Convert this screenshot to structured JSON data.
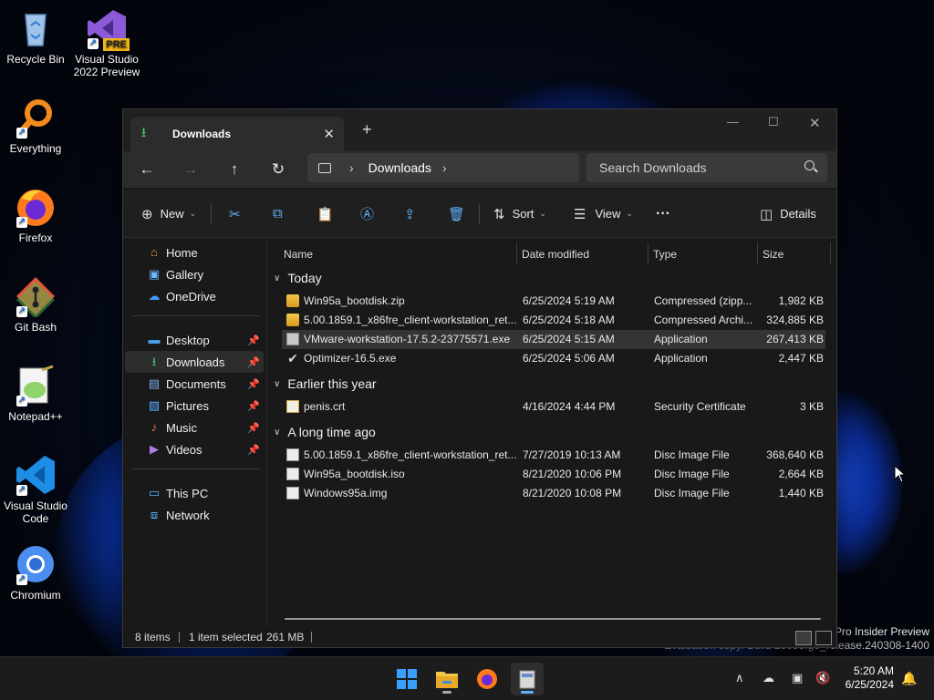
{
  "desktop": {
    "icons": [
      {
        "label": "Recycle Bin"
      },
      {
        "label": "Visual Studio 2022 Preview",
        "badge": "PRE"
      },
      {
        "label": "Everything"
      },
      {
        "label": "Firefox"
      },
      {
        "label": "Git Bash"
      },
      {
        "label": "Notepad++"
      },
      {
        "label": "Visual Studio Code"
      },
      {
        "label": "Chromium"
      }
    ],
    "watermark": {
      "line1": "Pro Insider Preview",
      "line2": "Evaluation copy. Build 26058.ge_release.240308-1400"
    }
  },
  "window": {
    "tab": {
      "title": "Downloads",
      "icon": "download-icon"
    },
    "address": {
      "crumb": "Downloads"
    },
    "search": {
      "placeholder": "Search Downloads"
    },
    "commands": {
      "new_label": "New",
      "sort_label": "Sort",
      "view_label": "View",
      "details_label": "Details"
    },
    "nav": {
      "items": [
        {
          "label": "Home"
        },
        {
          "label": "Gallery"
        },
        {
          "label": "OneDrive"
        },
        {
          "label": "Desktop"
        },
        {
          "label": "Downloads"
        },
        {
          "label": "Documents"
        },
        {
          "label": "Pictures"
        },
        {
          "label": "Music"
        },
        {
          "label": "Videos"
        },
        {
          "label": "This PC"
        },
        {
          "label": "Network"
        }
      ]
    },
    "columns": {
      "name": "Name",
      "date": "Date modified",
      "type": "Type",
      "size": "Size"
    },
    "groups": {
      "today": "Today",
      "earlier": "Earlier this year",
      "longago": "A long time ago"
    },
    "files": [
      {
        "name": "Win95a_bootdisk.zip",
        "date": "6/25/2024 5:19 AM",
        "type": "Compressed (zipp...",
        "size": "1,982 KB"
      },
      {
        "name": "5.00.1859.1_x86fre_client-workstation_ret...",
        "date": "6/25/2024 5:18 AM",
        "type": "Compressed Archi...",
        "size": "324,885 KB"
      },
      {
        "name": "VMware-workstation-17.5.2-23775571.exe",
        "date": "6/25/2024 5:15 AM",
        "type": "Application",
        "size": "267,413 KB"
      },
      {
        "name": "Optimizer-16.5.exe",
        "date": "6/25/2024 5:06 AM",
        "type": "Application",
        "size": "2,447 KB"
      },
      {
        "name": "penis.crt",
        "date": "4/16/2024 4:44 PM",
        "type": "Security Certificate",
        "size": "3 KB"
      },
      {
        "name": "5.00.1859.1_x86fre_client-workstation_ret...",
        "date": "7/27/2019 10:13 AM",
        "type": "Disc Image File",
        "size": "368,640 KB"
      },
      {
        "name": "Win95a_bootdisk.iso",
        "date": "8/21/2020 10:06 PM",
        "type": "Disc Image File",
        "size": "2,664 KB"
      },
      {
        "name": "Windows95a.img",
        "date": "8/21/2020 10:08 PM",
        "type": "Disc Image File",
        "size": "1,440 KB"
      }
    ],
    "status": {
      "count": "8 items",
      "selection": "1 item selected",
      "size": "261 MB"
    }
  },
  "taskbar": {
    "clock": {
      "time": "5:20 AM",
      "date": "6/25/2024"
    }
  }
}
